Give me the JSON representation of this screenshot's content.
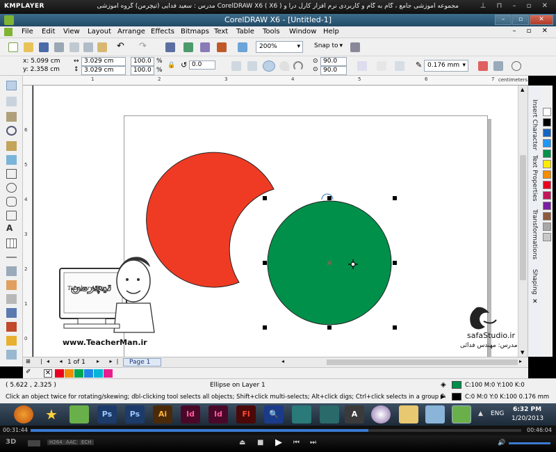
{
  "kmplayer": {
    "logo": "KMPLAYER",
    "title": "مجموعه آموزشی جامع ، گام به گام و کاربردی نرم افزار کارل درا و CorelDRAW X6 ( X6 )     مدرس : سعید فدایی (تیچرمن) گروه آموزشی پادشاه گرافیست ها",
    "time_current": "00:31:44",
    "time_total": "00:46:04",
    "ctrl_labels": [
      "H264",
      "AAC",
      "ECH"
    ]
  },
  "app": {
    "title": "CorelDRAW X6 - [Untitled-1]"
  },
  "menu": [
    "File",
    "Edit",
    "View",
    "Layout",
    "Arrange",
    "Effects",
    "Bitmaps",
    "Text",
    "Table",
    "Tools",
    "Window",
    "Help"
  ],
  "toolbar": {
    "zoom": "200%",
    "snap_to": "Snap to"
  },
  "property_bar": {
    "x": "x: 5.099 cm",
    "y": "y: 2.358 cm",
    "width": "3.029 cm",
    "height": "3.029 cm",
    "scale_w": "100.0",
    "scale_h": "100.0",
    "pct": "%",
    "rotation": "0.0",
    "start_angle": "90.0",
    "end_angle": "90.0",
    "outline_width": "0.176 mm"
  },
  "ruler": {
    "unit": "centimeters",
    "h_ticks": [
      "1",
      "2",
      "3",
      "4",
      "5",
      "6",
      "7"
    ],
    "v_ticks": [
      "6",
      "5",
      "4",
      "3",
      "2",
      "1",
      "0"
    ],
    "v_unit": "centimeters"
  },
  "dockers": [
    "Insert Character",
    "Text Properties",
    "Transformations",
    "Shaping"
  ],
  "page_nav": {
    "count": "1 of 1",
    "tab": "Page 1"
  },
  "status": {
    "coords": "( 5.622 , 2.325 )",
    "object": "Ellipse on Layer 1",
    "hint": "Click an object twice for rotating/skewing; dbl-clicking tool selects all objects; Shift+click multi-selects; Alt+click digs; Ctrl+click selects in a group ▶",
    "fill": "C:100 M:0 Y:100 K:0",
    "outline": "C:0 M:0 Y:0 K:100  0.176 mm"
  },
  "taskbar": {
    "lang": "ENG",
    "time": "6:32 PM",
    "date": "1/20/2013"
  },
  "watermarks": {
    "teacher_url": "www.TeacherMan.ir",
    "teacher_name": "Teacher Man",
    "safa_url": "safaStudio.ir",
    "safa_caption": "مدرس: مهندس فدائی"
  },
  "colors": {
    "red_shape": "#ef3b24",
    "green_circle": "#00904a",
    "fill_swatch": "#00904a",
    "outline_swatch": "#000000"
  },
  "palette": [
    "#ffffff",
    "#000000",
    "#1565c0",
    "#2196f3",
    "#00904a",
    "#ffeb00",
    "#f28c00",
    "#e8001e",
    "#c2185b",
    "#7b1fa2",
    "#8d5a3b",
    "#a8a8a8",
    "#c8c8c8"
  ],
  "doc_palette": [
    "#e8001e",
    "#f28c00",
    "#00a650",
    "#1e88e5",
    "#00b5d8",
    "#e91e8c"
  ]
}
